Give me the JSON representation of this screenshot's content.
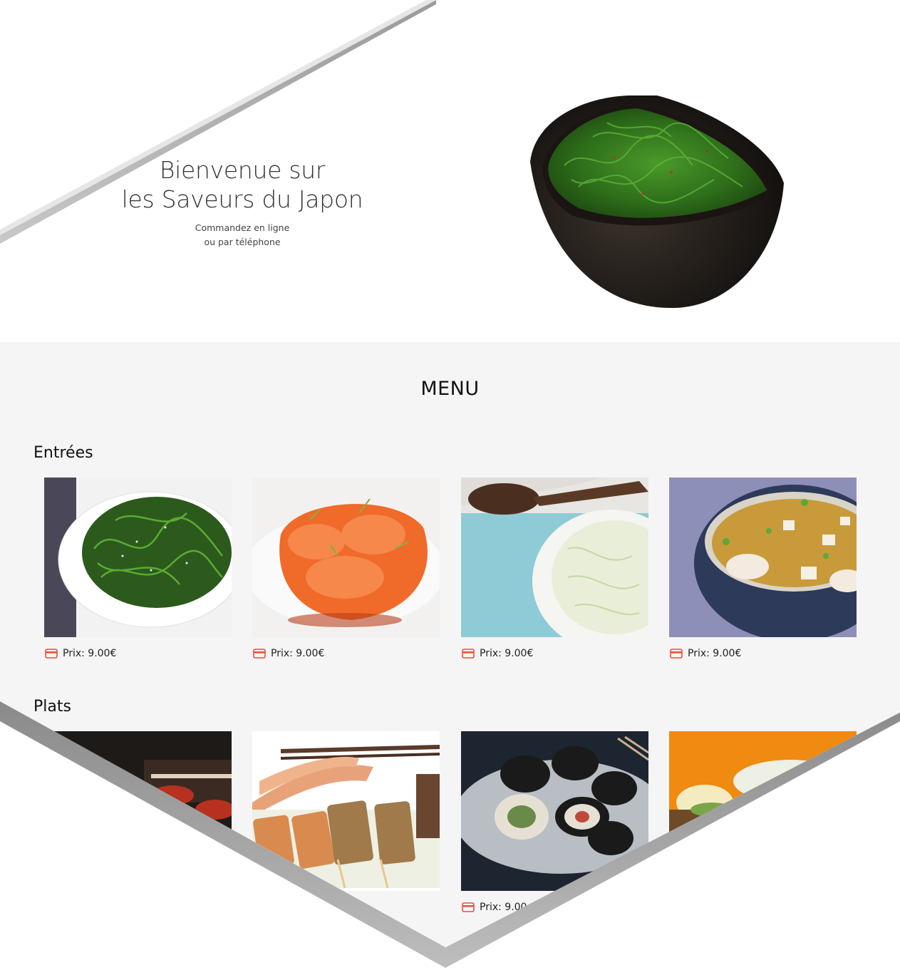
{
  "hero": {
    "title_line1": "Bienvenue sur",
    "title_line2": "les Saveurs du Japon",
    "subtitle_line1": "Commandez en ligne",
    "subtitle_line2": "ou par téléphone"
  },
  "menu": {
    "title": "MENU",
    "categories": [
      {
        "name": "Entrées",
        "items": [
          {
            "image": "seaweed-salad",
            "price": "Prix: 9.00€"
          },
          {
            "image": "salmon-tartare",
            "price": "Prix: 9.00€"
          },
          {
            "image": "cabbage-salad",
            "price": "Prix: 9.00€"
          },
          {
            "image": "miso-soup",
            "price": "Prix: 9.00€"
          }
        ]
      },
      {
        "name": "Plats",
        "items": [
          {
            "image": "grilled-meat",
            "price": ""
          },
          {
            "image": "yakitori-skewers",
            "price": ""
          },
          {
            "image": "maki-rolls",
            "price": "Prix: 9.00"
          },
          {
            "image": "orange-dish",
            "price": ""
          }
        ]
      }
    ]
  },
  "colors": {
    "accent": "#e8503a",
    "menu_bg": "#f5f5f5",
    "text": "#222222"
  }
}
